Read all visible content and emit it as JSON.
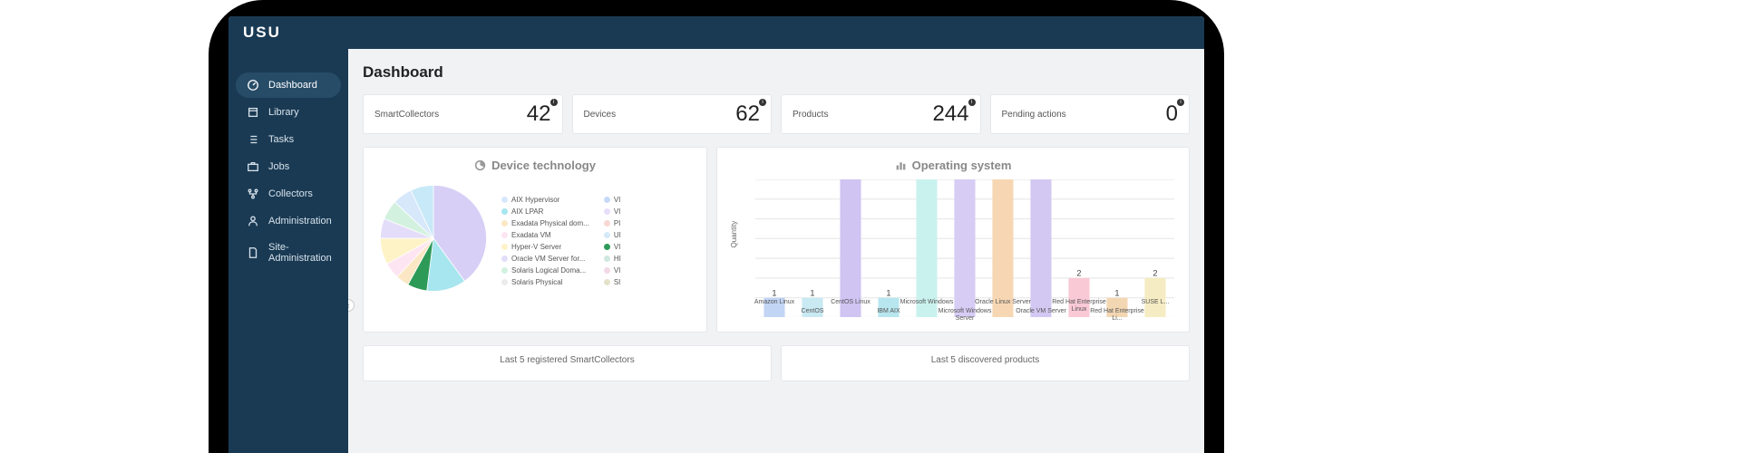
{
  "brand": "USU",
  "page_title": "Dashboard",
  "sidebar": {
    "items": [
      {
        "label": "Dashboard",
        "icon": "gauge",
        "active": true
      },
      {
        "label": "Library",
        "icon": "library",
        "active": false
      },
      {
        "label": "Tasks",
        "icon": "list",
        "active": false
      },
      {
        "label": "Jobs",
        "icon": "briefcase",
        "active": false
      },
      {
        "label": "Collectors",
        "icon": "nodes",
        "active": false
      },
      {
        "label": "Administration",
        "icon": "user",
        "active": false
      },
      {
        "label": "Site-Administration",
        "icon": "doc",
        "active": false
      }
    ]
  },
  "stats": [
    {
      "label": "SmartCollectors",
      "value": "42"
    },
    {
      "label": "Devices",
      "value": "62"
    },
    {
      "label": "Products",
      "value": "244"
    },
    {
      "label": "Pending actions",
      "value": "0"
    }
  ],
  "pie_title": "Device technology",
  "bar_title": "Operating system",
  "bar_ylabel": "Quantity",
  "lower": [
    {
      "title": "Last 5 registered SmartCollectors"
    },
    {
      "title": "Last 5 discovered products"
    }
  ],
  "chart_data": {
    "pie": {
      "type": "pie",
      "title": "Device technology",
      "legend_col1": [
        {
          "label": "AIX Hypervisor",
          "color": "#d8e8fb"
        },
        {
          "label": "AIX LPAR",
          "color": "#a7e6ef"
        },
        {
          "label": "Exadata Physical dom...",
          "color": "#fbe7c4"
        },
        {
          "label": "Exadata VM",
          "color": "#fde5f1"
        },
        {
          "label": "Hyper-V Server",
          "color": "#fef3c7"
        },
        {
          "label": "Oracle VM Server for...",
          "color": "#e4ddf9"
        },
        {
          "label": "Solaris Logical Doma...",
          "color": "#d3f1df"
        },
        {
          "label": "Solaris Physical",
          "color": "#ececec"
        }
      ],
      "legend_col2": [
        {
          "label": "VI",
          "color": "#c7d9f8"
        },
        {
          "label": "VI",
          "color": "#e8ddfa"
        },
        {
          "label": "PI",
          "color": "#f8d8d2"
        },
        {
          "label": "UI",
          "color": "#d5e9f9"
        },
        {
          "label": "VI",
          "color": "#2e9a58"
        },
        {
          "label": "HI",
          "color": "#cfe8e1"
        },
        {
          "label": "VI",
          "color": "#f3d8e6"
        },
        {
          "label": "SI",
          "color": "#e4e2c9"
        }
      ],
      "slices": [
        {
          "value": 40,
          "color": "#d7cff6"
        },
        {
          "value": 12,
          "color": "#a7e6ef"
        },
        {
          "value": 6,
          "color": "#2e9a58"
        },
        {
          "value": 4,
          "color": "#fbe7c4"
        },
        {
          "value": 5,
          "color": "#fde5f1"
        },
        {
          "value": 8,
          "color": "#fef3c7"
        },
        {
          "value": 6,
          "color": "#e4ddf9"
        },
        {
          "value": 6,
          "color": "#d3f1df"
        },
        {
          "value": 6,
          "color": "#d8e8fb"
        },
        {
          "value": 7,
          "color": "#c8e9f7"
        }
      ]
    },
    "bar": {
      "type": "bar",
      "title": "Operating system",
      "xlabel": "",
      "ylabel": "Quantity",
      "ylim": [
        0,
        7
      ],
      "yticks": [
        0,
        1,
        2,
        3,
        4,
        5,
        6,
        7
      ],
      "categories": [
        "Amazon Linux",
        "CentOS",
        "CentOS Linux",
        "IBM AIX",
        "Microsoft Windows",
        "Microsoft Windows Server",
        "Oracle Linux Server",
        "Oracle VM Server",
        "Red Hat Enterprise Linux",
        "Red Hat Enterprise Li...",
        "SUSE L..."
      ],
      "values": [
        1,
        1,
        7,
        1,
        7,
        7,
        7,
        7,
        2,
        1,
        2
      ],
      "colors": [
        "#c2d5f5",
        "#c9e9f3",
        "#cfc4f2",
        "#b8e6ef",
        "#c9f2ee",
        "#d6ccf4",
        "#f7d7b3",
        "#d3c8f2",
        "#f9c9d5",
        "#f3d7b3",
        "#f5ecc3"
      ]
    }
  }
}
